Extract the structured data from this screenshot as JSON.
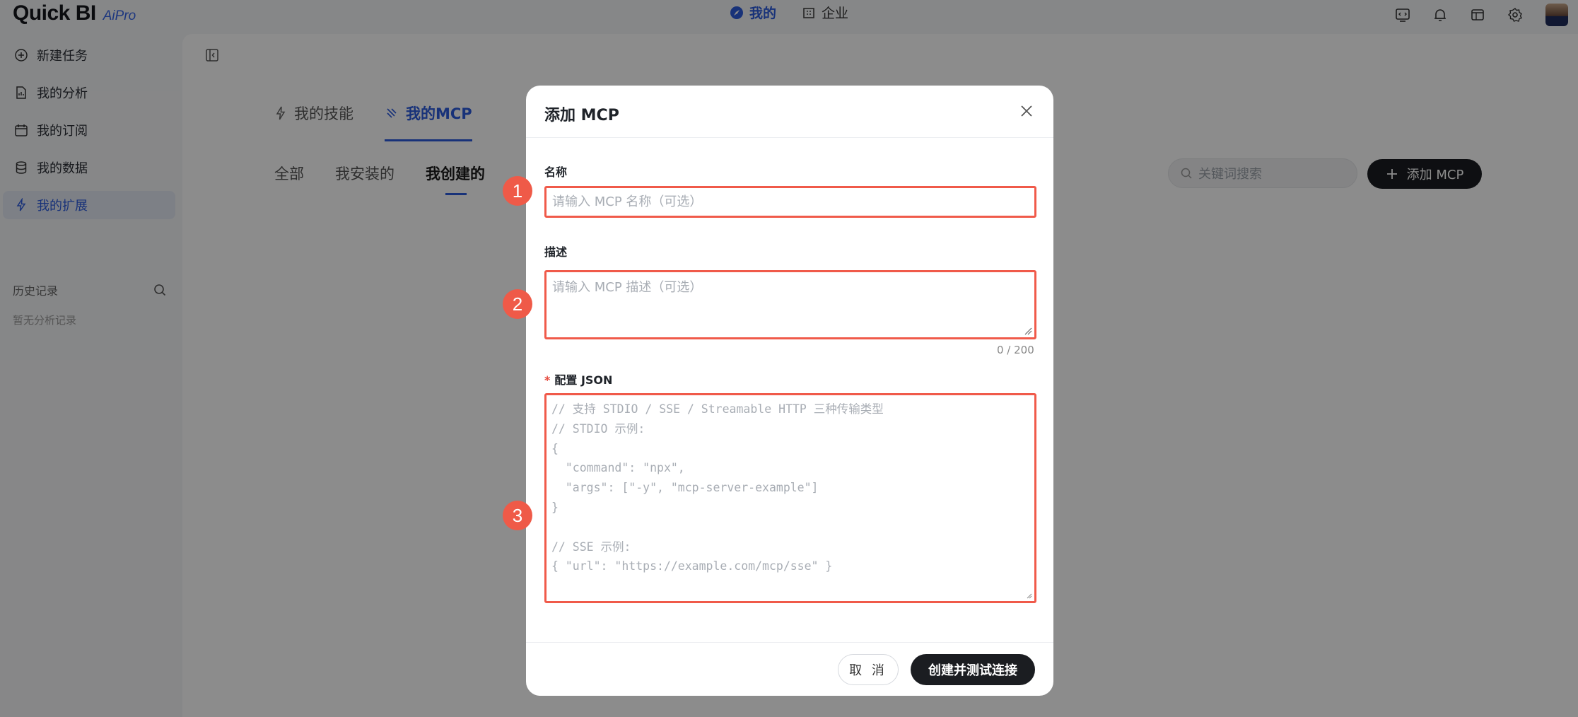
{
  "app": {
    "logo": "Quick BI",
    "badge": "AiPro"
  },
  "top_nav": {
    "mine": "我的",
    "enterprise": "企业"
  },
  "sidebar": {
    "items": [
      {
        "label": "新建任务",
        "icon": "plus-circle-icon"
      },
      {
        "label": "我的分析",
        "icon": "analysis-icon"
      },
      {
        "label": "我的订阅",
        "icon": "calendar-icon"
      },
      {
        "label": "我的数据",
        "icon": "database-icon"
      },
      {
        "label": "我的扩展",
        "icon": "lightning-icon"
      }
    ],
    "history_title": "历史记录",
    "history_empty": "暂无分析记录"
  },
  "main": {
    "tabs": [
      {
        "label": "我的技能"
      },
      {
        "label": "我的MCP"
      }
    ],
    "sub_tabs": [
      {
        "label": "全部"
      },
      {
        "label": "我安装的"
      },
      {
        "label": "我创建的"
      }
    ],
    "search_placeholder": "关键词搜索",
    "add_button": "添加 MCP"
  },
  "modal": {
    "title": "添加 MCP",
    "name_label": "名称",
    "name_placeholder": "请输入 MCP 名称（可选）",
    "desc_label": "描述",
    "desc_placeholder": "请输入 MCP 描述（可选）",
    "desc_counter": "0 / 200",
    "json_required_mark": "*",
    "json_label": "配置 JSON",
    "json_placeholder": "// 支持 STDIO / SSE / Streamable HTTP 三种传输类型\n// STDIO 示例:\n{\n  \"command\": \"npx\",\n  \"args\": [\"-y\", \"mcp-server-example\"]\n}\n\n// SSE 示例:\n{ \"url\": \"https://example.com/mcp/sse\" }",
    "cancel_button": "取 消",
    "submit_button": "创建并测试连接"
  },
  "markers": [
    "1",
    "2",
    "3"
  ],
  "colors": {
    "accent": "#2c5bdc",
    "highlight": "#f05a4a",
    "primary_button": "#1b1d21"
  }
}
